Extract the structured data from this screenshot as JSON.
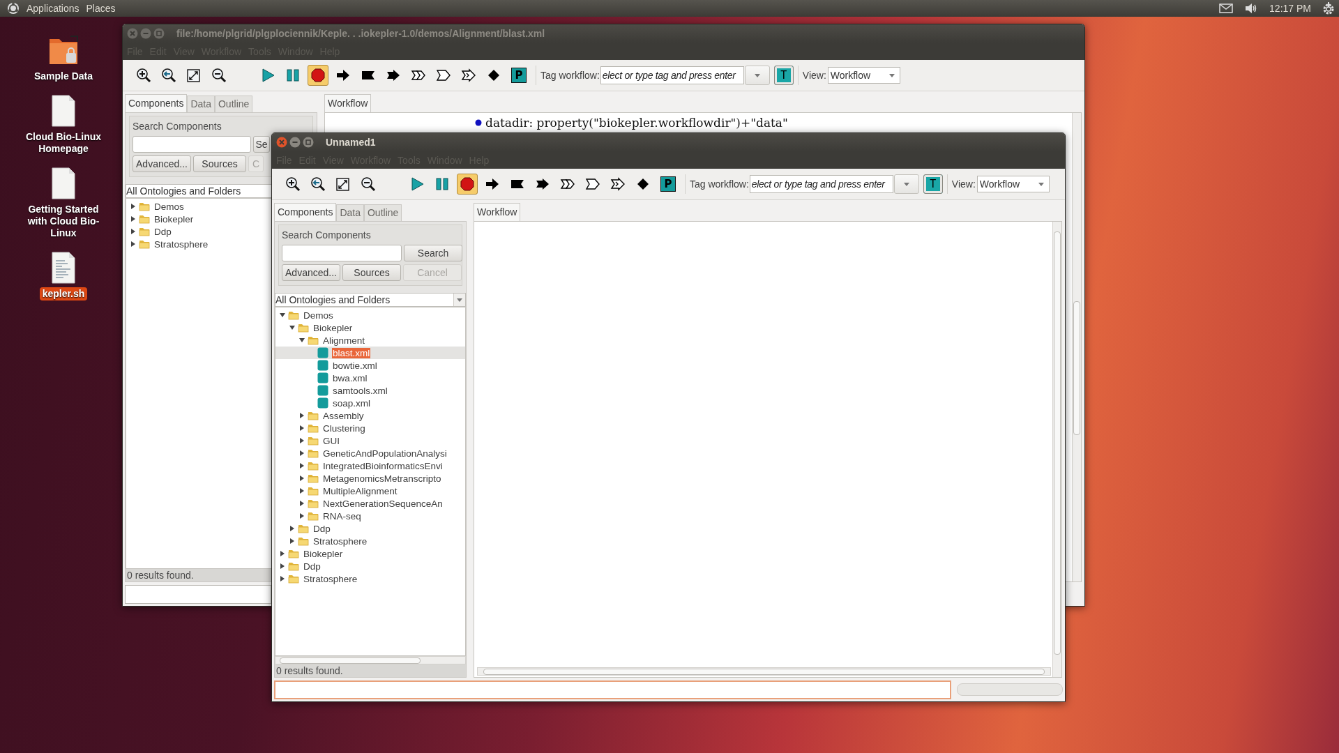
{
  "top_panel": {
    "menus": [
      "Applications",
      "Places"
    ],
    "clock": "12:17 PM"
  },
  "desktop_icons": [
    {
      "label": "Sample Data",
      "kind": "folder",
      "selected": false
    },
    {
      "label": "Cloud Bio-Linux Homepage",
      "kind": "document",
      "selected": false
    },
    {
      "label": "Getting Started with Cloud Bio-Linux",
      "kind": "document",
      "selected": false
    },
    {
      "label": "kepler.sh",
      "kind": "script",
      "selected": true
    }
  ],
  "windows": [
    {
      "title": "file:/home/plgrid/plgplociennik/Keple. . .iokepler-1.0/demos/Alignment/blast.xml",
      "active": false,
      "menus": [
        "File",
        "Edit",
        "View",
        "Workflow",
        "Tools",
        "Window",
        "Help"
      ],
      "toolbar": {
        "buttons": [
          {
            "kind": "zoom-in",
            "pressed": false
          },
          {
            "kind": "zoom-reset",
            "pressed": false
          },
          {
            "kind": "zoom-fit",
            "pressed": false
          },
          {
            "kind": "zoom-out",
            "pressed": false
          },
          {
            "kind": "run",
            "pressed": false
          },
          {
            "kind": "pause",
            "pressed": false
          },
          {
            "kind": "stop",
            "pressed": true
          },
          {
            "kind": "step",
            "pressed": false
          },
          {
            "kind": "flag",
            "pressed": false
          },
          {
            "kind": "notched-arrow",
            "pressed": false
          },
          {
            "kind": "double-chevron",
            "pressed": false
          },
          {
            "kind": "outline-arrow",
            "pressed": false
          },
          {
            "kind": "outline-double-arrow",
            "pressed": false
          },
          {
            "kind": "diamond",
            "pressed": false
          },
          {
            "kind": "marker",
            "label": "P",
            "pressed": false
          }
        ],
        "tag_label": "Tag workflow:",
        "tag_placeholder": "elect or type tag and press enter",
        "tag_button": "T",
        "view_label": "View:",
        "view_value": "Workflow"
      },
      "left_tabs": [
        {
          "label": "Components",
          "selected": true
        },
        {
          "label": "Data",
          "selected": false
        },
        {
          "label": "Outline",
          "selected": false
        }
      ],
      "search": {
        "title": "Search Components",
        "search_button": "Se",
        "buttons": [
          {
            "label": "Advanced...",
            "disabled": false
          },
          {
            "label": "Sources",
            "disabled": false
          },
          {
            "label": "C",
            "disabled": true
          }
        ]
      },
      "ontology_filter": "All Ontologies and Folders",
      "tree": [
        {
          "label": "Demos",
          "kind": "folder",
          "expanded": false,
          "selected": false
        },
        {
          "label": "Biokepler",
          "kind": "folder",
          "expanded": false,
          "selected": false
        },
        {
          "label": "Ddp",
          "kind": "folder",
          "expanded": false,
          "selected": false
        },
        {
          "label": "Stratosphere",
          "kind": "folder",
          "expanded": false,
          "selected": false
        }
      ],
      "results": "0 results found.",
      "editor_tabs": [
        {
          "label": "Workflow",
          "selected": true
        }
      ],
      "canvas_text": "datadir: property(\"biokepler.workflowdir\")+\"data\""
    },
    {
      "title": "Unnamed1",
      "active": true,
      "menus": [
        "File",
        "Edit",
        "View",
        "Workflow",
        "Tools",
        "Window",
        "Help"
      ],
      "toolbar": {
        "buttons": [
          {
            "kind": "zoom-in",
            "pressed": false
          },
          {
            "kind": "zoom-reset",
            "pressed": false
          },
          {
            "kind": "zoom-fit",
            "pressed": false
          },
          {
            "kind": "zoom-out",
            "pressed": false
          },
          {
            "kind": "run",
            "pressed": false
          },
          {
            "kind": "pause",
            "pressed": false
          },
          {
            "kind": "stop",
            "pressed": true
          },
          {
            "kind": "step",
            "pressed": false
          },
          {
            "kind": "flag",
            "pressed": false
          },
          {
            "kind": "notched-arrow",
            "pressed": false
          },
          {
            "kind": "double-chevron",
            "pressed": false
          },
          {
            "kind": "outline-arrow",
            "pressed": false
          },
          {
            "kind": "outline-double-arrow",
            "pressed": false
          },
          {
            "kind": "diamond",
            "pressed": false
          },
          {
            "kind": "marker",
            "label": "P",
            "pressed": false
          }
        ],
        "tag_label": "Tag workflow:",
        "tag_placeholder": "elect or type tag and press enter",
        "tag_button": "T",
        "view_label": "View:",
        "view_value": "Workflow"
      },
      "left_tabs": [
        {
          "label": "Components",
          "selected": true
        },
        {
          "label": "Data",
          "selected": false
        },
        {
          "label": "Outline",
          "selected": false
        }
      ],
      "search": {
        "title": "Search Components",
        "search_button": "Search",
        "buttons": [
          {
            "label": "Advanced...",
            "disabled": false
          },
          {
            "label": "Sources",
            "disabled": false
          },
          {
            "label": "Cancel",
            "disabled": true
          }
        ]
      },
      "ontology_filter": "All Ontologies and Folders",
      "tree": [
        {
          "label": "Demos",
          "kind": "folder",
          "expanded": true,
          "selected": false,
          "children": [
            {
              "label": "Biokepler",
              "kind": "folder",
              "expanded": true,
              "selected": false,
              "children": [
                {
                  "label": "Alignment",
                  "kind": "folder",
                  "expanded": true,
                  "selected": false,
                  "children": [
                    {
                      "label": "blast.xml",
                      "kind": "workflow",
                      "selected": true
                    },
                    {
                      "label": "bowtie.xml",
                      "kind": "workflow",
                      "selected": false
                    },
                    {
                      "label": "bwa.xml",
                      "kind": "workflow",
                      "selected": false
                    },
                    {
                      "label": "samtools.xml",
                      "kind": "workflow",
                      "selected": false
                    },
                    {
                      "label": "soap.xml",
                      "kind": "workflow",
                      "selected": false
                    }
                  ]
                },
                {
                  "label": "Assembly",
                  "kind": "folder",
                  "expanded": false,
                  "selected": false
                },
                {
                  "label": "Clustering",
                  "kind": "folder",
                  "expanded": false,
                  "selected": false
                },
                {
                  "label": "GUI",
                  "kind": "folder",
                  "expanded": false,
                  "selected": false
                },
                {
                  "label": "GeneticAndPopulationAnalysi",
                  "kind": "folder",
                  "expanded": false,
                  "selected": false
                },
                {
                  "label": "IntegratedBioinformaticsEnvi",
                  "kind": "folder",
                  "expanded": false,
                  "selected": false
                },
                {
                  "label": "MetagenomicsMetranscripto",
                  "kind": "folder",
                  "expanded": false,
                  "selected": false
                },
                {
                  "label": "MultipleAlignment",
                  "kind": "folder",
                  "expanded": false,
                  "selected": false
                },
                {
                  "label": "NextGenerationSequenceAn",
                  "kind": "folder",
                  "expanded": false,
                  "selected": false
                },
                {
                  "label": "RNA-seq",
                  "kind": "folder",
                  "expanded": false,
                  "selected": false
                }
              ]
            },
            {
              "label": "Ddp",
              "kind": "folder",
              "expanded": false,
              "selected": false
            },
            {
              "label": "Stratosphere",
              "kind": "folder",
              "expanded": false,
              "selected": false
            }
          ]
        },
        {
          "label": "Biokepler",
          "kind": "folder",
          "expanded": false,
          "selected": false
        },
        {
          "label": "Ddp",
          "kind": "folder",
          "expanded": false,
          "selected": false
        },
        {
          "label": "Stratosphere",
          "kind": "folder",
          "expanded": false,
          "selected": false
        }
      ],
      "results": "0 results found.",
      "editor_tabs": [
        {
          "label": "Workflow",
          "selected": true
        }
      ]
    }
  ]
}
